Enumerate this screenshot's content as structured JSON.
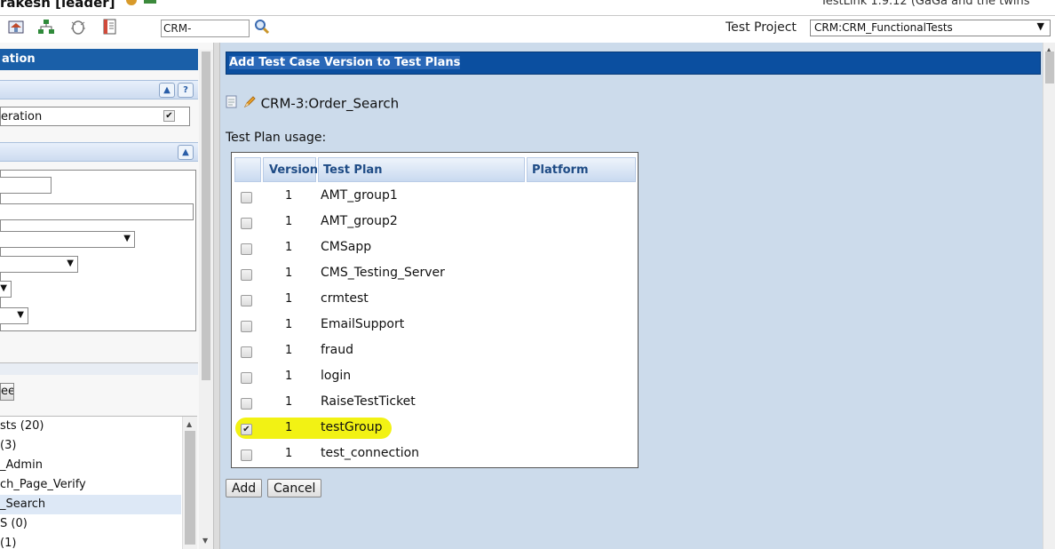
{
  "topbar": {
    "user": "rakesh [leader]",
    "app_title": "TestLink 1.9.12 (GaGa and the twins",
    "search_value": "CRM-",
    "test_project_label": "Test Project",
    "test_project_value": "CRM:CRM_FunctionalTests",
    "icons": [
      "home-icon",
      "tree-icon",
      "bug-icon",
      "document-icon",
      "search-icon"
    ]
  },
  "left_panel": {
    "header": "ation",
    "row_text": "eration",
    "button_text": "ee",
    "tree_items": [
      "sts (20)",
      "(3)",
      "_Admin",
      "ch_Page_Verify",
      "_Search",
      "S (0)",
      "(1)"
    ],
    "selected_tree_index": 4
  },
  "main": {
    "header": "Add Test Case Version to Test Plans",
    "test_case": "CRM-3:Order_Search",
    "usage_label": "Test Plan usage:",
    "columns": {
      "version": "Version",
      "test_plan": "Test Plan",
      "platform": "Platform"
    },
    "rows": [
      {
        "version": "1",
        "plan": "AMT_group1",
        "checked": false
      },
      {
        "version": "1",
        "plan": "AMT_group2",
        "checked": false
      },
      {
        "version": "1",
        "plan": "CMSapp",
        "checked": false
      },
      {
        "version": "1",
        "plan": "CMS_Testing_Server",
        "checked": false
      },
      {
        "version": "1",
        "plan": "crmtest",
        "checked": false
      },
      {
        "version": "1",
        "plan": "EmailSupport",
        "checked": false
      },
      {
        "version": "1",
        "plan": "fraud",
        "checked": false
      },
      {
        "version": "1",
        "plan": "login",
        "checked": false
      },
      {
        "version": "1",
        "plan": "RaiseTestTicket",
        "checked": false
      },
      {
        "version": "1",
        "plan": "testGroup",
        "checked": true,
        "highlighted": true
      },
      {
        "version": "1",
        "plan": "test_connection",
        "checked": false
      }
    ],
    "add_label": "Add",
    "cancel_label": "Cancel"
  },
  "colors": {
    "header_blue": "#0b4fa0",
    "panel_bg": "#ccdbeb",
    "highlight": "#f2f214"
  }
}
